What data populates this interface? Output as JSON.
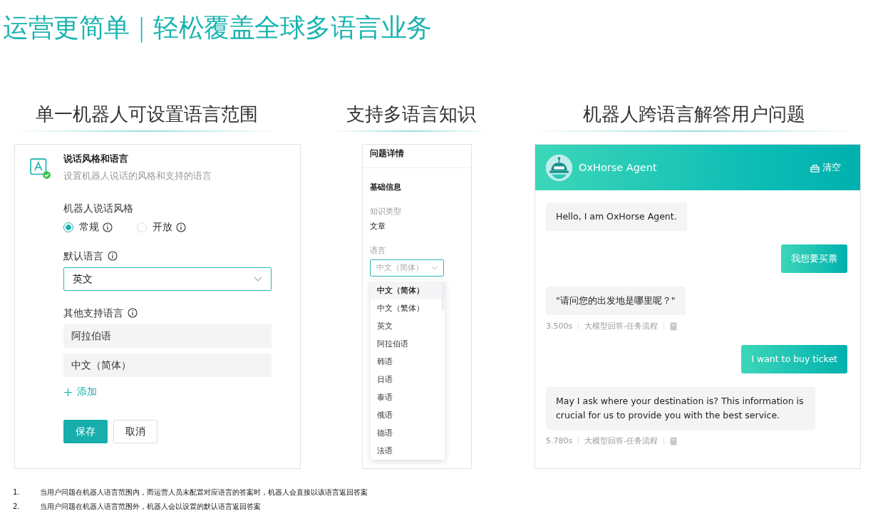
{
  "title": "运营更简单 | 轻松覆盖全球多语言业务",
  "settings_panel": {
    "heading": "单一机器人可设置语言范围",
    "title": "说话风格和语言",
    "subtitle": "设置机器人说话的风格和支持的语言",
    "style_label": "机器人说话风格",
    "style_options": [
      {
        "label": "常规",
        "selected": true
      },
      {
        "label": "开放",
        "selected": false
      }
    ],
    "default_language_label": "默认语言",
    "default_language": "英文",
    "other_languages_label": "其他支持语言",
    "other_languages": [
      "阿拉伯语",
      "中文（简体）"
    ],
    "add_link": "添加",
    "buttons": [
      {
        "label": "保存",
        "kind": "primary"
      },
      {
        "label": "取消",
        "kind": "default"
      }
    ]
  },
  "knowledge_panel": {
    "heading": "支持多语言知识",
    "title": "问题详情",
    "section": "基础信息",
    "type_label": "知识类型",
    "type_value": "文章",
    "language_label": "语言",
    "language_placeholder": "中文（简体）",
    "options": [
      {
        "label": "中文（简体）",
        "selected": true
      },
      {
        "label": "中文（繁体）",
        "selected": false
      },
      {
        "label": "英文",
        "selected": false
      },
      {
        "label": "阿拉伯语",
        "selected": false
      },
      {
        "label": "韩语",
        "selected": false
      },
      {
        "label": "日语",
        "selected": false
      },
      {
        "label": "泰语",
        "selected": false
      },
      {
        "label": "俄语",
        "selected": false
      },
      {
        "label": "德语",
        "selected": false
      },
      {
        "label": "法语",
        "selected": false
      }
    ]
  },
  "chat_panel": {
    "heading": "机器人跨语言解答用户问题",
    "agent_name": "OxHorse Agent",
    "clear_button": "清空",
    "messages": [
      {
        "kind": "bot",
        "text": "Hello, I am OxHorse Agent."
      },
      {
        "kind": "user",
        "text": "我想要买票"
      },
      {
        "kind": "bot",
        "text": "\"请问您的出发地是哪里呢？\"",
        "time": "3.500s",
        "source": "大模型回答-任务流程"
      },
      {
        "kind": "user",
        "text": "I want to buy ticket"
      },
      {
        "kind": "bot",
        "text": "May I ask where your destination is? This information is crucial for us to provide you with the best service.",
        "time": "5.780s",
        "source": "大模型回答-任务流程"
      }
    ]
  },
  "footnotes": [
    {
      "number": "1.",
      "text": "当用户问题在机器人语言范围内，而运营人员未配置对应语言的答案时，机器人会直接以该语言返回答案"
    },
    {
      "number": "2.",
      "text": "当用户问题在机器人语言范围外，机器人会以设置的默认语言返回答案"
    }
  ]
}
